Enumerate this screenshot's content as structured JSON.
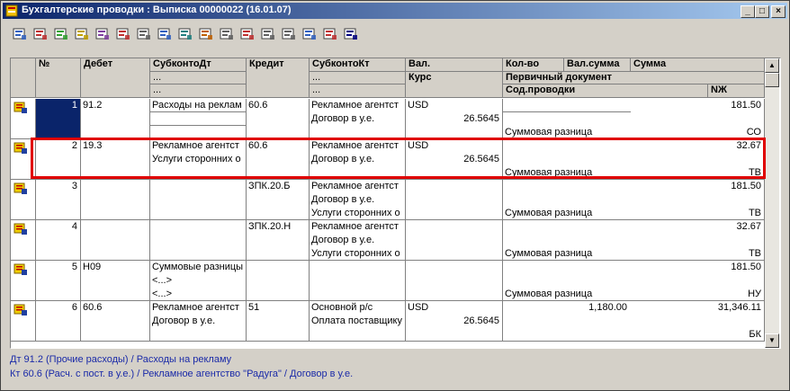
{
  "window": {
    "title": "Бухгалтерские проводки : Выписка 00000022 (16.01.07)"
  },
  "window_buttons": {
    "minimize": "_",
    "maximize": "□",
    "close": "×"
  },
  "toolbar": {
    "items": [
      "new-row",
      "copy-row",
      "edit-row",
      "new-group",
      "delete-row",
      "mark-delete",
      "move",
      "post",
      "search",
      "find-next",
      "column-width",
      "clear",
      "cut",
      "paste",
      "filter",
      "select",
      "help"
    ]
  },
  "columns": {
    "num": "№",
    "debit": "Дебет",
    "subkonto_dt": "СубконтоДт",
    "credit": "Кредит",
    "subkonto_kt": "СубконтоКт",
    "val": "Вал.",
    "kurs": "Курс",
    "qty": "Кол-во",
    "val_sum": "Вал.сумма",
    "sum": "Сумма",
    "primary_doc": "Первичный документ",
    "content": "Сод.проводки",
    "nzh": "NЖ",
    "dots": "..."
  },
  "rows": [
    {
      "num": "1",
      "debit": "91.2",
      "sdt": [
        "Расходы на реклам",
        "",
        ""
      ],
      "credit": "60.6",
      "skt": [
        "Рекламное агентст",
        "Договор в у.е.",
        ""
      ],
      "val": "USD",
      "kurs": "26.5645",
      "qty": "",
      "valsum": "",
      "sum": "181.50",
      "content": "Суммовая разница",
      "nzh": "СО"
    },
    {
      "num": "2",
      "debit": "19.3",
      "sdt": [
        "Рекламное агентст",
        "Услуги сторонних о",
        ""
      ],
      "credit": "60.6",
      "skt": [
        "Рекламное агентст",
        "Договор в у.е.",
        ""
      ],
      "val": "USD",
      "kurs": "26.5645",
      "qty": "",
      "valsum": "",
      "sum": "32.67",
      "content": "Суммовая разница",
      "nzh": "ТВ"
    },
    {
      "num": "3",
      "debit": "",
      "sdt": [
        "",
        "",
        ""
      ],
      "credit": "ЗПК.20.Б",
      "skt": [
        "Рекламное агентст",
        "Договор в у.е.",
        "Услуги сторонних о"
      ],
      "val": "",
      "kurs": "",
      "qty": "",
      "valsum": "",
      "sum": "181.50",
      "content": "Суммовая разница",
      "nzh": "ТВ"
    },
    {
      "num": "4",
      "debit": "",
      "sdt": [
        "",
        "",
        ""
      ],
      "credit": "ЗПК.20.Н",
      "skt": [
        "Рекламное агентст",
        "Договор в у.е.",
        "Услуги сторонних о"
      ],
      "val": "",
      "kurs": "",
      "qty": "",
      "valsum": "",
      "sum": "32.67",
      "content": "Суммовая разница",
      "nzh": "ТВ"
    },
    {
      "num": "5",
      "debit": "Н09",
      "sdt": [
        "Суммовые разницы",
        "<...>",
        "<...>"
      ],
      "credit": "",
      "skt": [
        "",
        "",
        ""
      ],
      "val": "",
      "kurs": "",
      "qty": "",
      "valsum": "",
      "sum": "181.50",
      "content": "Суммовая разница",
      "nzh": "НУ"
    },
    {
      "num": "6",
      "debit": "60.6",
      "sdt": [
        "Рекламное агентст",
        "Договор в у.е.",
        ""
      ],
      "credit": "51",
      "skt": [
        "Основной р/с",
        "Оплата поставщику",
        ""
      ],
      "val": "USD",
      "kurs": "26.5645",
      "qty": "",
      "valsum": "1,180.00",
      "sum": "31,346.11",
      "content": "",
      "nzh": "БК"
    }
  ],
  "status": {
    "line1": "Дт 91.2 (Прочие расходы) / Расходы на рекламу",
    "line2": "Кт 60.6 (Расч. с пост. в у.е.) / Рекламное агентство \"Радуга\" / Договор в у.е."
  },
  "colors": {
    "title_from": "#0a246a",
    "title_to": "#a6caf0",
    "highlight": "#e00000",
    "status_text": "#1a2aa8",
    "selected_cell": "#0a246a"
  }
}
